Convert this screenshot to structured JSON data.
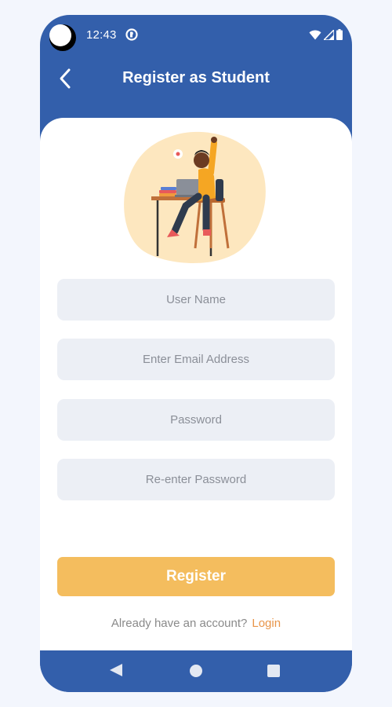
{
  "status_bar": {
    "time": "12:43",
    "icons": [
      "app-notification-icon",
      "wifi-icon",
      "signal-icon",
      "battery-icon"
    ]
  },
  "header": {
    "title": "Register as Student",
    "back_icon": "chevron-left-icon"
  },
  "illustration": {
    "subject": "student-at-desk-illustration"
  },
  "form": {
    "username_placeholder": "User Name",
    "email_placeholder": "Enter Email Address",
    "password_placeholder": "Password",
    "confirm_password_placeholder": "Re-enter Password",
    "register_label": "Register"
  },
  "footer": {
    "prompt": "Already have an account?",
    "login_label": "Login"
  },
  "nav_bar": {
    "icons": [
      "nav-back-icon",
      "nav-home-icon",
      "nav-recents-icon"
    ]
  },
  "colors": {
    "primary": "#335fab",
    "accent": "#f4bd5e",
    "link": "#e8954a",
    "field_bg": "#eceff5",
    "page_bg": "#f3f6fd"
  }
}
